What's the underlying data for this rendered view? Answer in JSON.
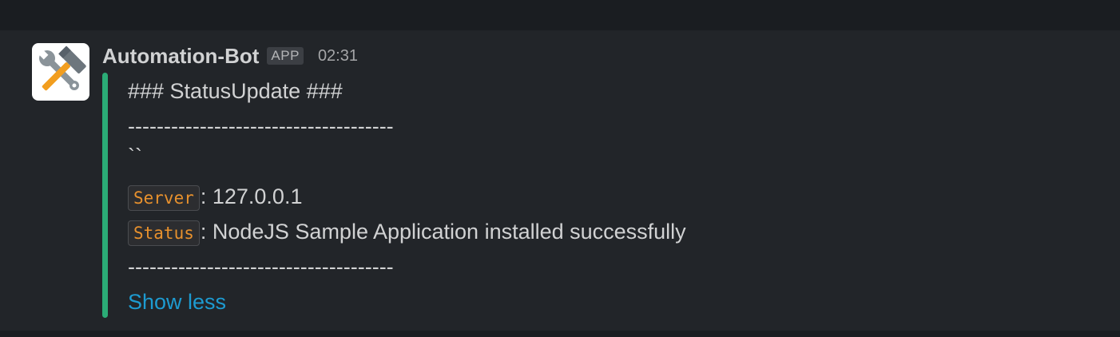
{
  "message": {
    "bot_name": "Automation-Bot",
    "app_badge": "APP",
    "timestamp": "02:31",
    "avatar_icon": "hammer-and-wrench-icon",
    "accent_color": "#2bac76"
  },
  "attachment": {
    "title": "### StatusUpdate ###",
    "separator_top": "-------------------------------------",
    "backticks": "``",
    "fields": [
      {
        "key": "Server",
        "value": ": 127.0.0.1"
      },
      {
        "key": "Status",
        "value": ": NodeJS Sample Application installed successfully"
      }
    ],
    "separator_bottom": "-------------------------------------",
    "show_less": "Show less"
  }
}
